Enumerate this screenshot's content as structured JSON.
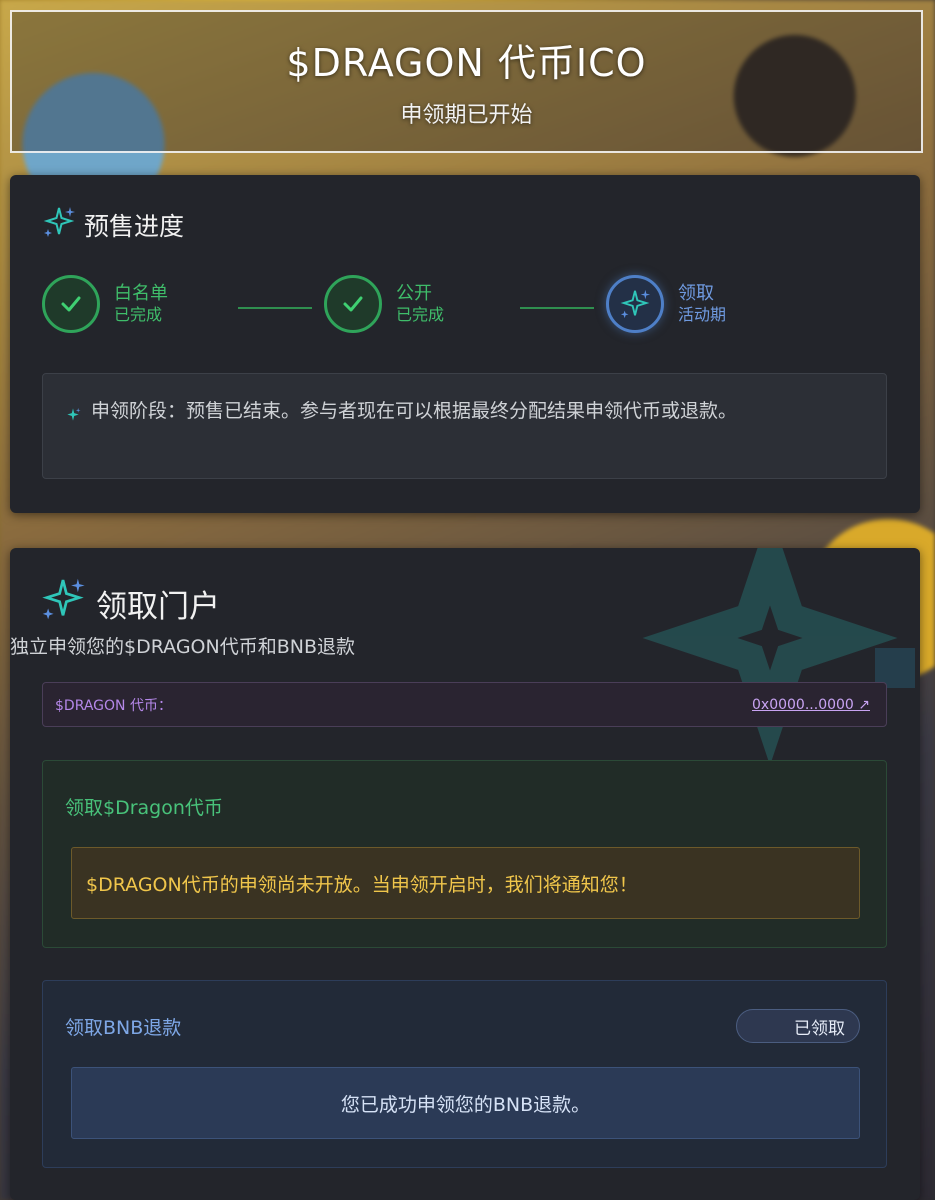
{
  "header": {
    "title": "$DRAGON 代币ICO",
    "subtitle": "申领期已开始"
  },
  "progress": {
    "title": "预售进度",
    "steps": [
      {
        "name": "白名单",
        "status": "已完成",
        "state": "done"
      },
      {
        "name": "公开",
        "status": "已完成",
        "state": "done"
      },
      {
        "name": "领取",
        "status": "活动期",
        "state": "active"
      }
    ],
    "notice": "申领阶段：预售已结束。参与者现在可以根据最终分配结果申领代币或退款。"
  },
  "portal": {
    "title": "领取门户",
    "subtitle": "独立申领您的$DRAGON代币和BNB退款",
    "token_label": "$DRAGON 代币：",
    "token_address": "0x0000...0000 ↗",
    "dragon_panel": {
      "title": "领取$Dragon代币",
      "message": "$DRAGON代币的申领尚未开放。当申领开启时，我们将通知您！"
    },
    "bnb_panel": {
      "title": "领取BNB退款",
      "badge": "已领取",
      "message": "您已成功申领您的BNB退款。"
    }
  },
  "colors": {
    "done_green": "#3fbd6a",
    "active_blue": "#6f9ae0",
    "warn_yellow": "#f0c64b",
    "token_purple": "#b487e8"
  }
}
